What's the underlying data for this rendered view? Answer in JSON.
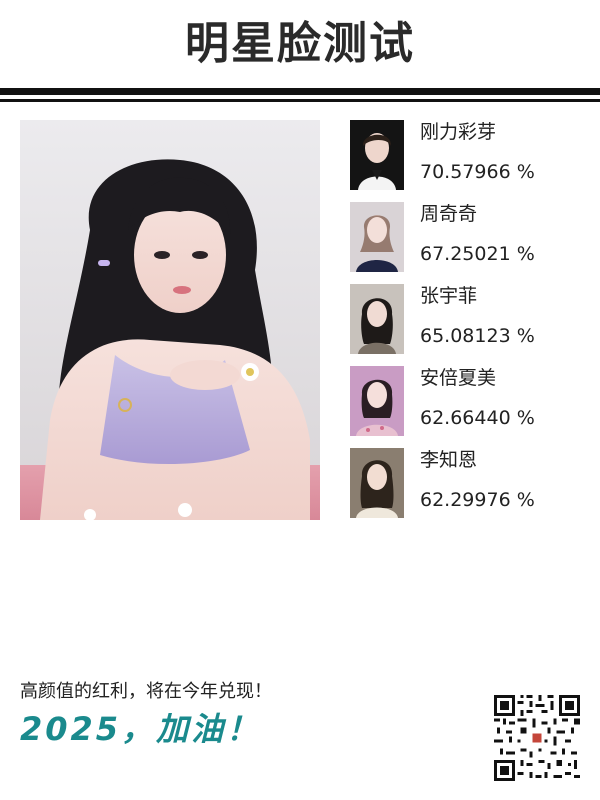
{
  "header": {
    "title": "明星脸测试"
  },
  "matches": [
    {
      "name": "刚力彩芽",
      "score": "70.57966 %"
    },
    {
      "name": "周奇奇",
      "score": "67.25021 %"
    },
    {
      "name": "张宇菲",
      "score": "65.08123 %"
    },
    {
      "name": "安倍夏美",
      "score": "62.66440 %"
    },
    {
      "name": "李知恩",
      "score": "62.29976 %"
    }
  ],
  "footer": {
    "tagline": "高颜值的红利，将在今年兑现！",
    "slogan": "2025，加油！"
  },
  "colors": {
    "slogan": "#1a8a8d",
    "title": "#2a2a2a"
  }
}
